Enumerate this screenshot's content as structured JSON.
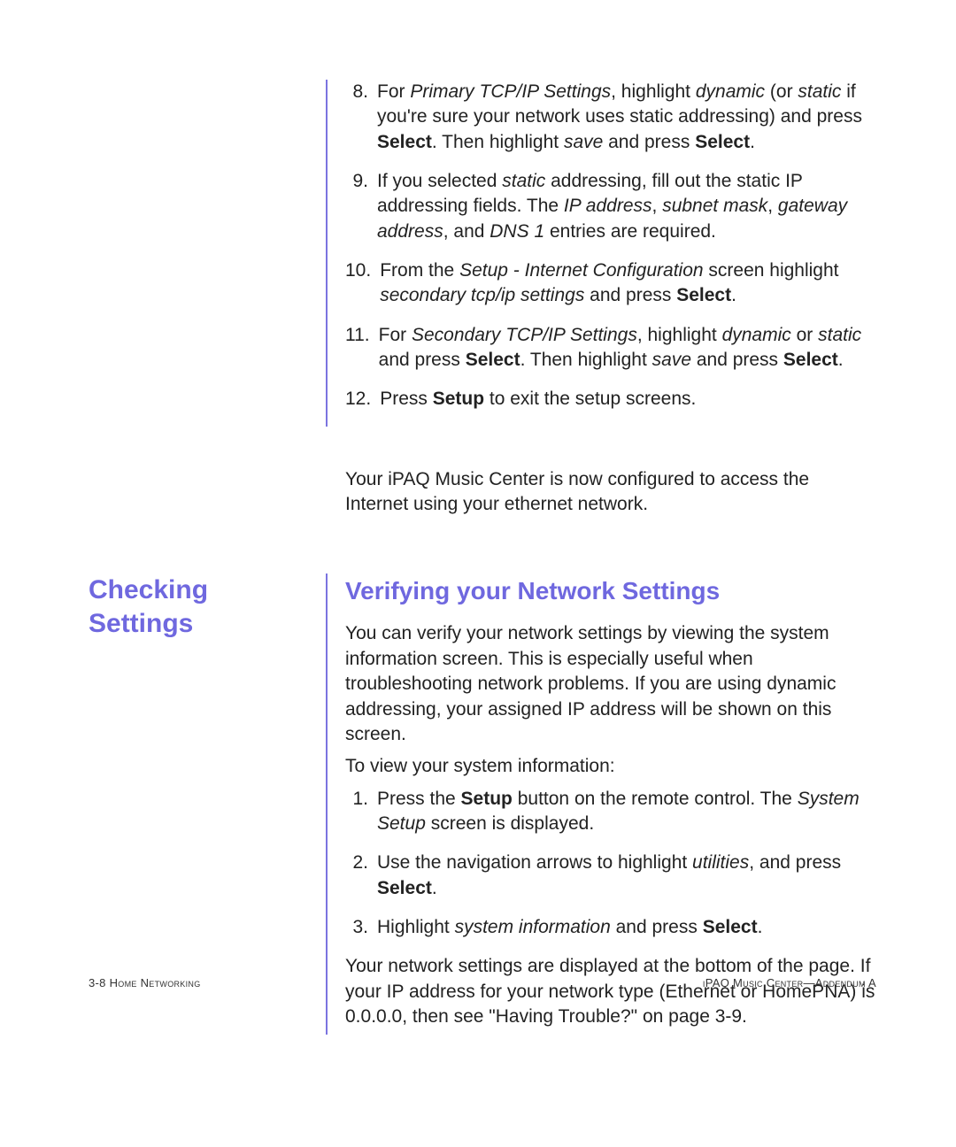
{
  "steps_top": [
    {
      "n": "8.",
      "html": "For <em>Primary TCP/IP Settings</em>, highlight <em>dynamic</em> (or <em>static</em> if you're sure your network uses static addressing) and press <strong>Select</strong>. Then highlight <em>save</em> and press <strong>Select</strong>."
    },
    {
      "n": "9.",
      "html": "If you selected <em>static</em> addressing, fill out the static IP addressing fields. The <em>IP address</em>, <em>subnet mask</em>, <em>gateway address</em>, and <em>DNS 1</em> entries are required."
    },
    {
      "n": "10.",
      "html": "From the <em>Setup - Internet Configuration</em> screen highlight <em>secondary tcp/ip settings</em> and press <strong>Select</strong>."
    },
    {
      "n": "11.",
      "html": "For <em>Secondary TCP/IP Settings</em>, highlight <em>dynamic</em> or <em>static</em> and press <strong>Select</strong>. Then highlight <em>save</em> and press <strong>Select</strong>."
    },
    {
      "n": "12.",
      "html": "Press <strong>Setup</strong> to exit the setup screens."
    }
  ],
  "para_configured": "Your iPAQ Music Center is now configured to access the Internet using your ethernet network.",
  "side_heading": "Checking Settings",
  "sub_heading": "Verifying your Network Settings",
  "para_verify": "You can verify your network settings by viewing the system information screen. This is especially useful when troubleshooting network problems. If you are using dynamic addressing, your assigned IP address will be shown on this screen.",
  "para_toview": "To view your system information:",
  "steps_bottom": [
    {
      "n": "1.",
      "html": "Press the <strong>Setup</strong> button on the remote control. The <em>System Setup</em> screen is displayed."
    },
    {
      "n": "2.",
      "html": "Use the navigation arrows to highlight <em>utilities</em>, and press <strong>Select</strong>."
    },
    {
      "n": "3.",
      "html": "Highlight <em>system information</em> and press <strong>Select</strong>."
    }
  ],
  "para_bottom": "Your network settings are displayed at the bottom of the page. If your IP address for your network type (Ethernet or HomePNA) is 0.0.0.0, then see \"Having Trouble?\" on page 3-9.",
  "footer_left_prefix": "3-8  ",
  "footer_left": "Home Networking",
  "footer_right": "iPAQ Music Center—Addendum A"
}
